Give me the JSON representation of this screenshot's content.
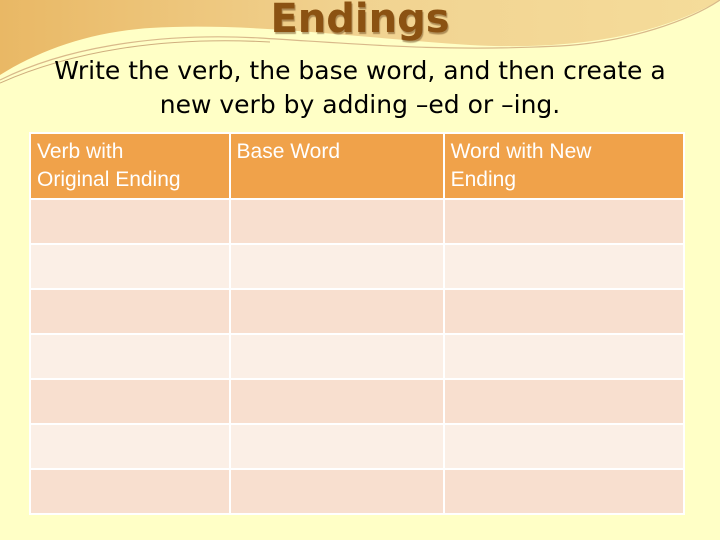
{
  "slide": {
    "title": "Endings",
    "instructions_line1": "Write the verb, the base word, and then create a",
    "instructions_line2": "new verb by adding –ed or –ing."
  },
  "table": {
    "headers": [
      {
        "line1": "Verb with",
        "line2": "Original Ending"
      },
      {
        "line1": "Base Word",
        "line2": ""
      },
      {
        "line1": "Word with New",
        "line2": "Ending"
      }
    ],
    "rows": [
      [
        "",
        "",
        ""
      ],
      [
        "",
        "",
        ""
      ],
      [
        "",
        "",
        ""
      ],
      [
        "",
        "",
        ""
      ],
      [
        "",
        "",
        ""
      ],
      [
        "",
        "",
        ""
      ],
      [
        "",
        "",
        ""
      ]
    ]
  },
  "colors": {
    "title": "#8b5212",
    "header_bg": "#f0a24a",
    "row_dark": "#f8dfcf",
    "row_light": "#fbefe6",
    "background": "#ffffc6"
  }
}
